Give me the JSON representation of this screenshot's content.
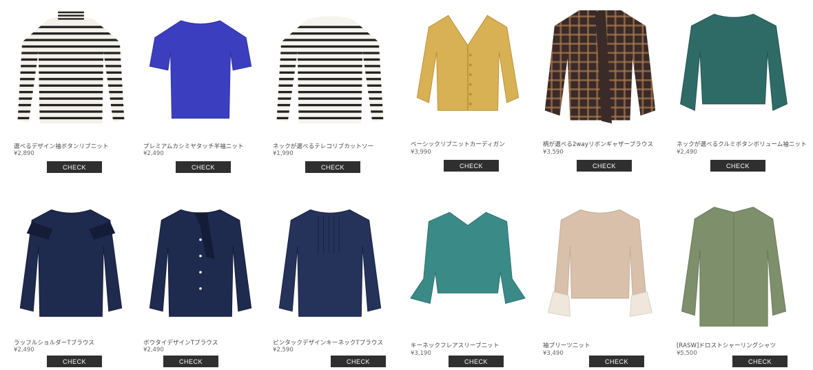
{
  "products": [
    {
      "name": "選べるデザイン袖ボタンリブニット",
      "price": "¥2,890",
      "check": "CHECK",
      "color": "#f4f1ea",
      "accent": "#222222",
      "type": "stripe-turtle"
    },
    {
      "name": "プレミアムカシミヤタッチ半袖ニット",
      "price": "¥2,490",
      "check": "CHECK",
      "color": "#3b3fbf",
      "accent": "#2c2fa0",
      "type": "short-knit"
    },
    {
      "name": "ネックが選べるテレコリブカットソー",
      "price": "¥1,990",
      "check": "CHECK",
      "color": "#f6f4ee",
      "accent": "#222222",
      "type": "stripe-tee"
    },
    {
      "name": "ベーシックリブニットカーディガン",
      "price": "¥3,990",
      "check": "CHECK",
      "color": "#d8b155",
      "accent": "#b78f33",
      "type": "cardigan"
    },
    {
      "name": "柄が選べる2wayリボンギャザーブラウス",
      "price": "¥3,590",
      "check": "CHECK",
      "color": "#3a2a28",
      "accent": "#a8794e",
      "type": "plaid"
    },
    {
      "name": "ネックが選べるクルミボタンボリューム袖ニット",
      "price": "¥2,490",
      "check": "CHECK",
      "color": "#2e6b66",
      "accent": "#24534f",
      "type": "volume-knit"
    },
    {
      "name": "ラッフルショルダーTブラウス",
      "price": "¥2,490",
      "check": "CHECK",
      "color": "#1f2a4f",
      "accent": "#141c37",
      "type": "ruffle"
    },
    {
      "name": "ボウタイデザインTブラウス",
      "price": "¥2,490",
      "check": "CHECK",
      "color": "#1f2a4f",
      "accent": "#141c37",
      "type": "bowtie"
    },
    {
      "name": "ピンタックデザインキーネックTブラウス",
      "price": "¥2,590",
      "check": "CHECK",
      "color": "#25325a",
      "accent": "#18213f",
      "type": "pintuck"
    },
    {
      "name": "キーネックフレアスリーブニット",
      "price": "¥3,190",
      "check": "CHECK",
      "color": "#3a8a88",
      "accent": "#2d6f6d",
      "type": "flare"
    },
    {
      "name": "袖プリーツニット",
      "price": "¥3,490",
      "check": "CHECK",
      "color": "#d8c0aa",
      "accent": "#efe7dc",
      "type": "pleat"
    },
    {
      "name": "[RASW]ドロストシャーリングシャツ",
      "price": "¥5,500",
      "check": "CHECK",
      "color": "#7e8f6c",
      "accent": "#687757",
      "type": "shirt"
    }
  ]
}
